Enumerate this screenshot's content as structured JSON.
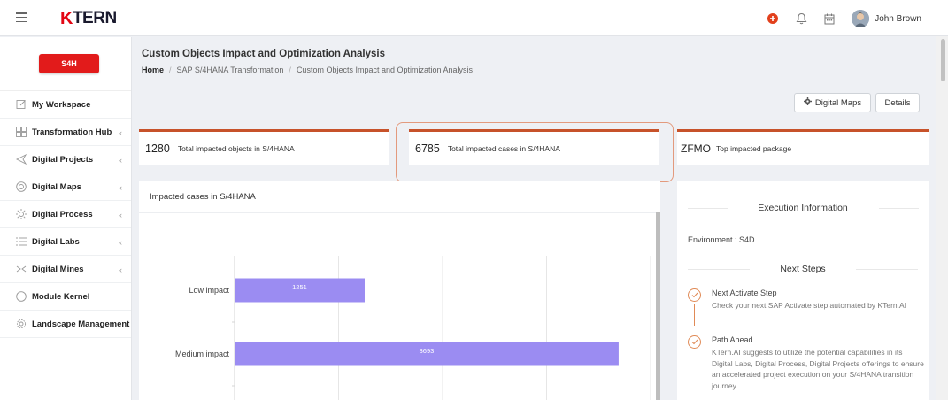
{
  "header": {
    "logo_text": "TERN",
    "logo_k": "K",
    "user_name": "John Brown"
  },
  "sidebar": {
    "badge": "S4H",
    "items": [
      {
        "label": "My Workspace",
        "chevron": false
      },
      {
        "label": "Transformation Hub",
        "chevron": true
      },
      {
        "label": "Digital Projects",
        "chevron": true
      },
      {
        "label": "Digital Maps",
        "chevron": true
      },
      {
        "label": "Digital Process",
        "chevron": true
      },
      {
        "label": "Digital Labs",
        "chevron": true
      },
      {
        "label": "Digital Mines",
        "chevron": true
      },
      {
        "label": "Module Kernel",
        "chevron": false
      },
      {
        "label": "Landscape Management",
        "chevron": false
      }
    ]
  },
  "page": {
    "title": "Custom Objects Impact and Optimization Analysis",
    "breadcrumb": {
      "home": "Home",
      "sep": "/",
      "level1": "SAP S/4HANA Transformation",
      "level2": "Custom Objects Impact and Optimization Analysis"
    },
    "buttons": {
      "digital_maps": "Digital Maps",
      "details": "Details"
    }
  },
  "kpis": [
    {
      "value": "1280",
      "label": "Total impacted objects in S/4HANA"
    },
    {
      "value": "6785",
      "label": "Total impacted cases in S/4HANA"
    },
    {
      "value": "ZFMO",
      "label": "Top impacted package"
    }
  ],
  "chart_card": {
    "title": "Impacted cases in S/4HANA"
  },
  "chart_data": {
    "type": "bar",
    "orientation": "horizontal",
    "title": "Impacted cases in S/4HANA",
    "categories": [
      "Low impact",
      "Medium impact"
    ],
    "values": [
      1251,
      3693
    ],
    "xlim": [
      0,
      4000
    ],
    "grid": true,
    "bar_color": "#9b8cf2"
  },
  "side_card": {
    "execution_title": "Execution Information",
    "environment": "Environment : S4D",
    "next_steps_title": "Next Steps",
    "steps": [
      {
        "title": "Next Activate Step",
        "desc": "Check your next SAP Activate step automated by KTern.AI"
      },
      {
        "title": "Path Ahead",
        "desc": "KTern.AI suggests to utilize the potential capabilities in its Digital Labs, Digital Process, Digital Projects offerings to ensure an accelerated project execution on your S/4HANA transition journey."
      }
    ]
  }
}
